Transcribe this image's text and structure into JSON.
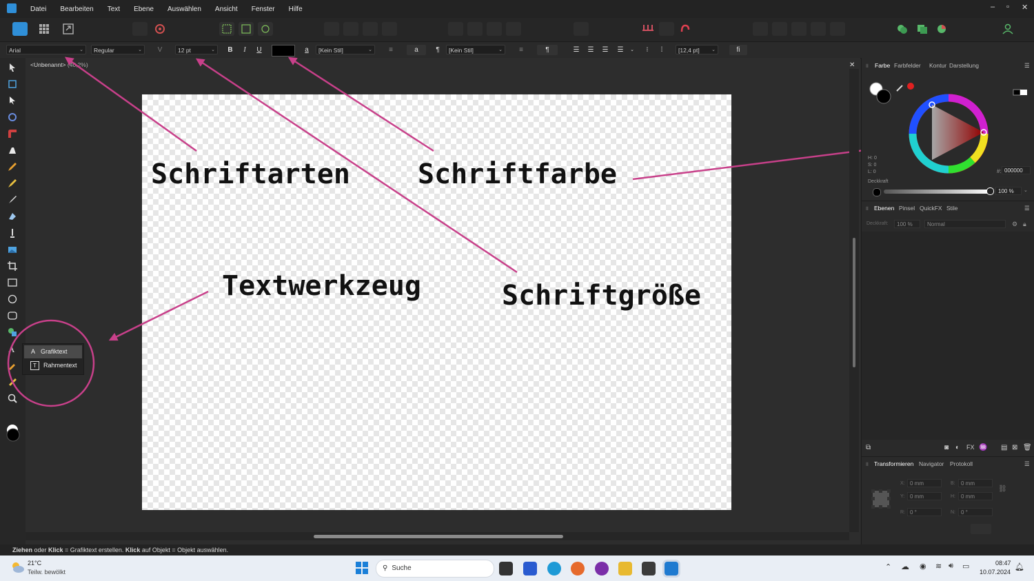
{
  "window": {
    "menu": [
      "Datei",
      "Bearbeiten",
      "Text",
      "Ebene",
      "Auswählen",
      "Ansicht",
      "Fenster",
      "Hilfe"
    ],
    "minimize": "–",
    "restore": "▫",
    "close": "✕"
  },
  "context_toolbar": {
    "font_family": "Arial",
    "font_style": "Regular",
    "font_size": "12 pt",
    "bold": "B",
    "italic": "I",
    "underline": "U",
    "text_color": "#000000",
    "char_style_icon": "a",
    "char_style": "[Kein Stil]",
    "lower_a": "a",
    "pilcrow": "¶",
    "para_style": "[Kein Stil]",
    "leading": "[12,4 pt]",
    "ligature": "fi"
  },
  "document": {
    "tab_title": "<Unbenannt>",
    "zoom": "(40,2%)",
    "close": "✕"
  },
  "annotations": {
    "fonts": "Schriftarten",
    "color": "Schriftfarbe",
    "tool": "Textwerkzeug",
    "size": "Schriftgröße",
    "arrow_color": "#c8408a"
  },
  "tool_flyout": {
    "items": [
      {
        "icon": "A",
        "label": "Grafiktext",
        "selected": true
      },
      {
        "icon": "T",
        "label": "Rahmentext",
        "selected": false
      }
    ]
  },
  "color_panel": {
    "tabs": [
      "Farbe",
      "Farbfelder",
      "Kontur",
      "Darstellung"
    ],
    "h": "H: 0",
    "s": "S: 0",
    "l": "L: 0",
    "hex_label": "#:",
    "hex": "000000",
    "opacity_label": "Deckkraft",
    "opacity": "100 %"
  },
  "layers_panel": {
    "tabs": [
      "Ebenen",
      "Pinsel",
      "QuickFX",
      "Stile"
    ],
    "opacity_label": "Deckkraft:",
    "opacity": "100 %",
    "blend_mode": "Normal"
  },
  "transform_panel": {
    "tabs": [
      "Transformieren",
      "Navigator",
      "Protokoll"
    ],
    "x_label": "X:",
    "x": "0 mm",
    "y_label": "Y:",
    "y": "0 mm",
    "w_label": "B:",
    "w": "0 mm",
    "h_label": "H:",
    "h": "0 mm",
    "r_label": "R:",
    "r": "0 °",
    "s_label": "N:",
    "s": "0 °"
  },
  "status": {
    "b1": "Ziehen",
    "t1": " oder ",
    "b2": "Klick",
    "t2": " = Grafiktext erstellen. ",
    "b3": "Klick",
    "t3": " auf Objekt = Objekt auswählen."
  },
  "taskbar": {
    "weather_temp": "21°C",
    "weather_desc": "Teilw. bewölkt",
    "search": "Suche",
    "time": "08:47",
    "date": "10.07.2024"
  }
}
